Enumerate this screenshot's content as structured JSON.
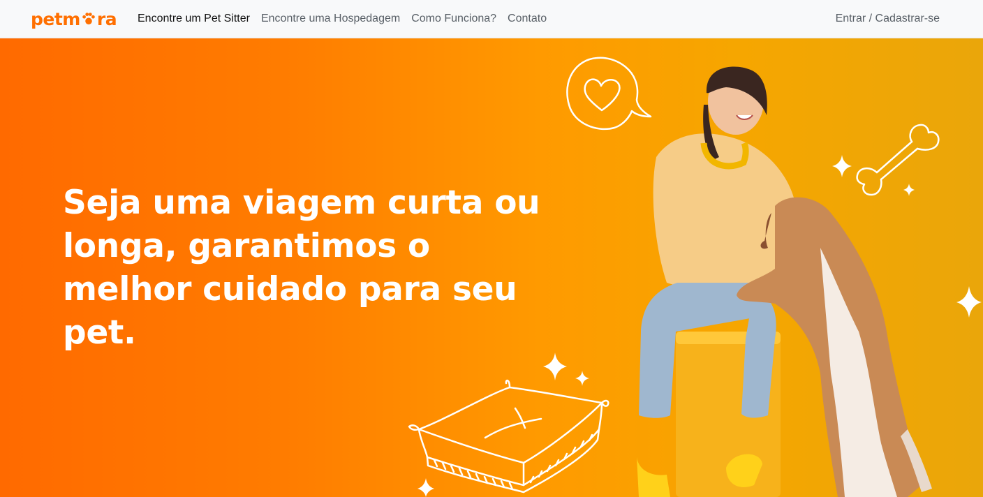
{
  "brand": {
    "text_before": "petm",
    "text_after": "ra"
  },
  "nav": {
    "links": [
      {
        "label": "Encontre um Pet Sitter"
      },
      {
        "label": "Encontre uma Hospedagem"
      },
      {
        "label": "Como Funciona?"
      },
      {
        "label": "Contato"
      }
    ],
    "auth_label": "Entrar / Cadastrar-se"
  },
  "hero": {
    "headline": "Seja uma viagem curta ou longa, garantimos o melhor cuidado para seu pet."
  },
  "colors": {
    "brand": "#ff6f00",
    "gradient_start": "#ff6a00",
    "gradient_end": "#eaa60a"
  },
  "icons": [
    "paw-icon",
    "heart-speech-bubble-icon",
    "bone-icon",
    "sparkle-icon",
    "pet-bed-illustration"
  ]
}
